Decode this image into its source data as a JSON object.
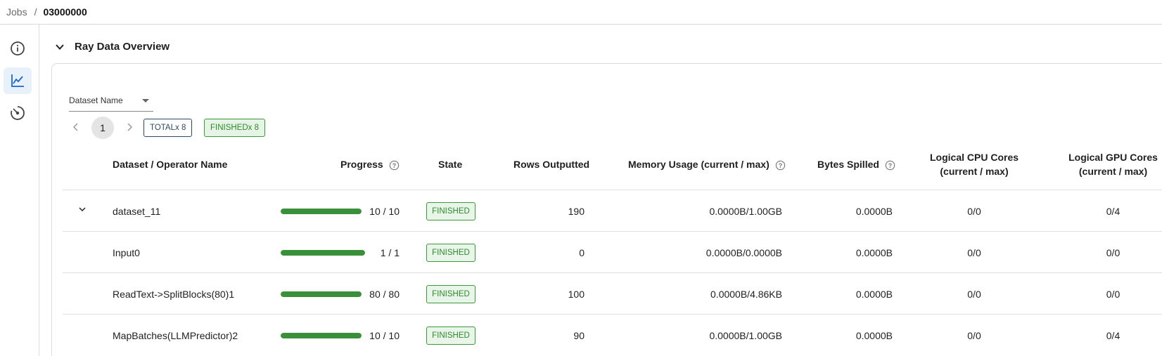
{
  "breadcrumb": {
    "root": "Jobs",
    "separator": "/",
    "current": "03000000"
  },
  "sidebar": {
    "items": [
      {
        "icon": "info-icon",
        "active": false
      },
      {
        "icon": "chart-line-icon",
        "active": true
      },
      {
        "icon": "radar-icon",
        "active": false
      }
    ]
  },
  "section": {
    "title": "Ray Data Overview"
  },
  "filter": {
    "dataset_label": "Dataset Name"
  },
  "pagination": {
    "current_page": "1"
  },
  "chips": {
    "total": "TOTALx 8",
    "finished": "FINISHEDx 8"
  },
  "table": {
    "headers": {
      "name": "Dataset / Operator Name",
      "progress": "Progress",
      "state": "State",
      "rows": "Rows Outputted",
      "memory": "Memory Usage (current / max)",
      "spilled": "Bytes Spilled",
      "cpu_line1": "Logical CPU Cores",
      "cpu_line2": "(current / max)",
      "gpu_line1": "Logical GPU Cores",
      "gpu_line2": "(current / max)"
    },
    "rows": [
      {
        "name": "dataset_11",
        "progress_text": "10 / 10",
        "progress": 1.0,
        "state": "FINISHED",
        "rows": "190",
        "memory": "0.0000B/1.00GB",
        "spilled": "0.0000B",
        "cpu": "0/0",
        "gpu": "0/4"
      },
      {
        "name": "Input0",
        "progress_text": "1 / 1",
        "progress": 1.0,
        "state": "FINISHED",
        "rows": "0",
        "memory": "0.0000B/0.0000B",
        "spilled": "0.0000B",
        "cpu": "0/0",
        "gpu": "0/0"
      },
      {
        "name": "ReadText->SplitBlocks(80)1",
        "progress_text": "80 / 80",
        "progress": 1.0,
        "state": "FINISHED",
        "rows": "100",
        "memory": "0.0000B/4.86KB",
        "spilled": "0.0000B",
        "cpu": "0/0",
        "gpu": "0/0"
      },
      {
        "name": "MapBatches(LLMPredictor)2",
        "progress_text": "10 / 10",
        "progress": 1.0,
        "state": "FINISHED",
        "rows": "90",
        "memory": "0.0000B/1.00GB",
        "spilled": "0.0000B",
        "cpu": "0/0",
        "gpu": "0/4"
      }
    ]
  },
  "colors": {
    "accent": "#1a66cc",
    "success": "#3a8f3a",
    "success_bg": "#e8f5e8"
  }
}
